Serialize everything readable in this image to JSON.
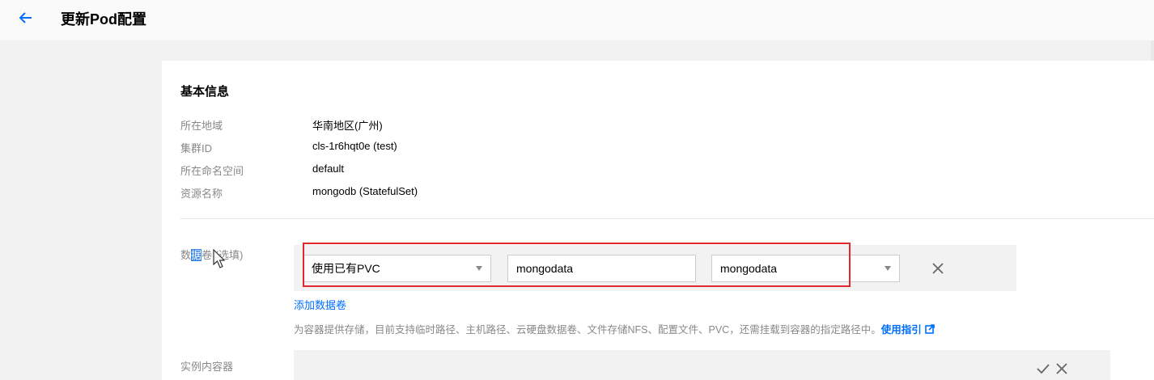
{
  "header": {
    "title": "更新Pod配置"
  },
  "basic_info": {
    "section_title": "基本信息",
    "rows": [
      {
        "label": "所在地域",
        "value": "华南地区(广州)"
      },
      {
        "label": "集群ID",
        "value": "cls-1r6hqt0e (test)"
      },
      {
        "label": "所在命名空间",
        "value": "default"
      },
      {
        "label": "资源名称",
        "value": "mongodb (StatefulSet)"
      }
    ]
  },
  "volumes": {
    "label_prefix": "数",
    "label_highlight": "据",
    "label_suffix": "卷 (选填)",
    "type_select": "使用已有PVC",
    "name_input": "mongodata",
    "pvc_select": "mongodata",
    "add_link": "添加数据卷",
    "help_text": "为容器提供存储，目前支持临时路径、主机路径、云硬盘数据卷、文件存储NFS、配置文件、PVC，还需挂载到容器的指定路径中。",
    "help_link": "使用指引"
  },
  "containers": {
    "label": "实例内容器"
  },
  "colors": {
    "accent": "#006eff",
    "highlight_box": "#e0282e"
  }
}
